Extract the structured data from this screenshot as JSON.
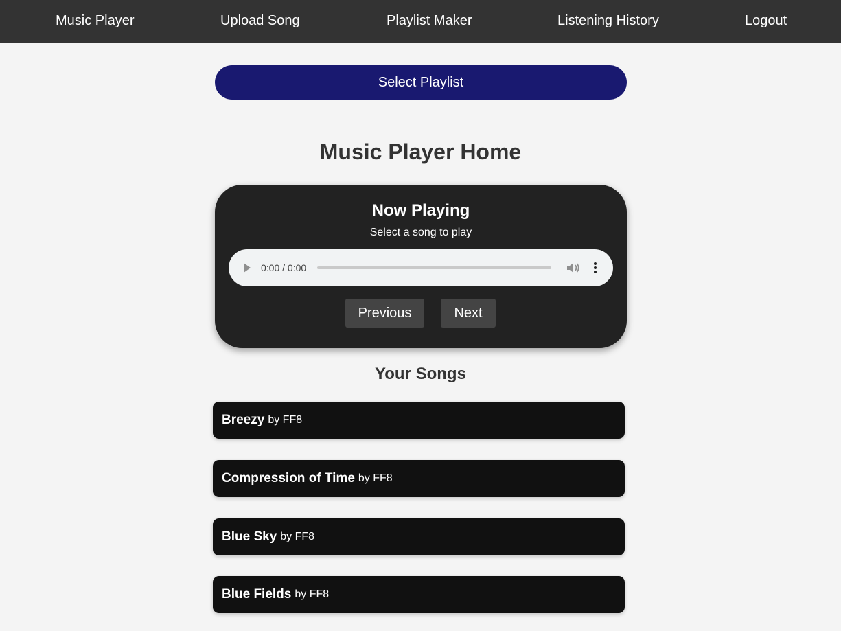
{
  "nav": {
    "items": [
      {
        "label": "Music Player"
      },
      {
        "label": "Upload Song"
      },
      {
        "label": "Playlist Maker"
      },
      {
        "label": "Listening History"
      },
      {
        "label": "Logout"
      }
    ]
  },
  "playlist": {
    "select_label": "Select Playlist"
  },
  "page": {
    "title": "Music Player Home"
  },
  "player": {
    "title": "Now Playing",
    "subtitle": "Select a song to play",
    "time": "0:00 / 0:00",
    "progress": 0,
    "icons": {
      "play": "play-icon",
      "volume": "volume-icon",
      "more": "more-options-icon"
    },
    "previous_label": "Previous",
    "next_label": "Next"
  },
  "songs": {
    "title": "Your Songs",
    "items": [
      {
        "title": "Breezy",
        "artist": "by FF8"
      },
      {
        "title": "Compression of Time",
        "artist": "by FF8"
      },
      {
        "title": "Blue Sky",
        "artist": "by FF8"
      },
      {
        "title": "Blue Fields",
        "artist": "by FF8"
      }
    ]
  },
  "colors": {
    "navbar": "#333333",
    "select_button": "#191970",
    "player_card": "#222222",
    "control_button": "#444444",
    "song_item": "#111111",
    "background": "#f4f4f4"
  }
}
